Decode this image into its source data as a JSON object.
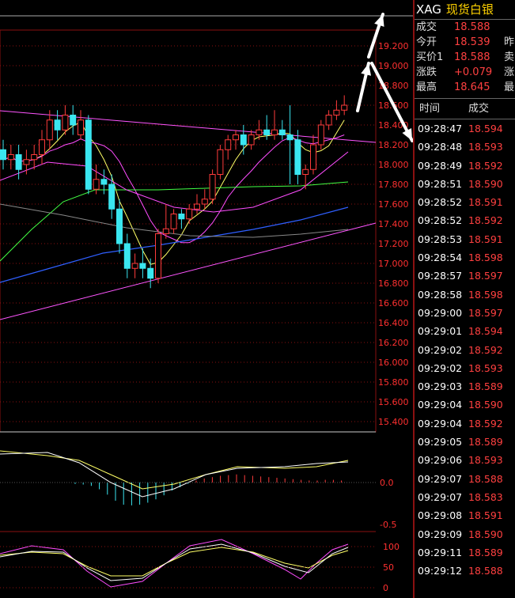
{
  "header": {
    "symbol": "XAG",
    "name": "现货白银"
  },
  "quote": [
    {
      "label": "成交",
      "value": "18.588",
      "cut": ""
    },
    {
      "label": "今开",
      "value": "18.539",
      "cut": "昨"
    },
    {
      "label": "买价1",
      "value": "18.588",
      "cut": "卖"
    },
    {
      "label": "涨跌",
      "value": "+0.079",
      "cut": "涨"
    },
    {
      "label": "最高",
      "value": "18.645",
      "cut": "最"
    }
  ],
  "ticks_header": {
    "time": "时间",
    "price": "成交"
  },
  "ticks": [
    {
      "time": "09:28:47",
      "price": "18.594"
    },
    {
      "time": "09:28:48",
      "price": "18.593"
    },
    {
      "time": "09:28:49",
      "price": "18.592"
    },
    {
      "time": "09:28:51",
      "price": "18.590"
    },
    {
      "time": "09:28:52",
      "price": "18.591"
    },
    {
      "time": "09:28:52",
      "price": "18.592"
    },
    {
      "time": "09:28:53",
      "price": "18.591"
    },
    {
      "time": "09:28:54",
      "price": "18.598"
    },
    {
      "time": "09:28:57",
      "price": "18.597"
    },
    {
      "time": "09:28:58",
      "price": "18.598"
    },
    {
      "time": "09:29:00",
      "price": "18.597"
    },
    {
      "time": "09:29:01",
      "price": "18.594"
    },
    {
      "time": "09:29:02",
      "price": "18.592"
    },
    {
      "time": "09:29:02",
      "price": "18.593"
    },
    {
      "time": "09:29:03",
      "price": "18.589"
    },
    {
      "time": "09:29:04",
      "price": "18.590"
    },
    {
      "time": "09:29:04",
      "price": "18.592"
    },
    {
      "time": "09:29:05",
      "price": "18.589"
    },
    {
      "time": "09:29:06",
      "price": "18.593"
    },
    {
      "time": "09:29:07",
      "price": "18.588"
    },
    {
      "time": "09:29:07",
      "price": "18.583"
    },
    {
      "time": "09:29:08",
      "price": "18.591"
    },
    {
      "time": "09:29:09",
      "price": "18.590"
    },
    {
      "time": "09:29:11",
      "price": "18.589"
    },
    {
      "time": "09:29:12",
      "price": "18.588"
    }
  ],
  "chart_data": {
    "type": "candlestick",
    "price_axis_ticks": [
      "19.200",
      "19.000",
      "18.800",
      "18.600",
      "18.400",
      "18.200",
      "18.000",
      "17.800",
      "17.600",
      "17.400",
      "17.200",
      "17.000",
      "16.800",
      "16.600",
      "16.400",
      "16.200",
      "16.000",
      "15.800",
      "15.600",
      "15.400"
    ],
    "macd_axis_ticks": [
      "0.0",
      "-0.5"
    ],
    "kdj_axis_ticks": [
      "100",
      "50",
      "0"
    ],
    "candles": [
      [
        18.15,
        18.05,
        18.25,
        17.95
      ],
      [
        18.05,
        18.1,
        18.2,
        17.95
      ],
      [
        18.1,
        17.95,
        18.2,
        17.85
      ],
      [
        18.0,
        18.05,
        18.15,
        17.9
      ],
      [
        18.05,
        18.1,
        18.2,
        17.95
      ],
      [
        18.1,
        18.25,
        18.35,
        18.0
      ],
      [
        18.25,
        18.45,
        18.55,
        18.15
      ],
      [
        18.45,
        18.35,
        18.55,
        18.25
      ],
      [
        18.35,
        18.5,
        18.6,
        18.3
      ],
      [
        18.5,
        18.4,
        18.6,
        18.3
      ],
      [
        18.3,
        18.45,
        18.55,
        18.25
      ],
      [
        18.45,
        17.75,
        18.5,
        17.7
      ],
      [
        17.75,
        17.85,
        18.0,
        17.7
      ],
      [
        17.85,
        17.8,
        17.95,
        17.7
      ],
      [
        17.8,
        17.55,
        17.9,
        17.45
      ],
      [
        17.55,
        17.2,
        17.65,
        17.1
      ],
      [
        17.2,
        16.95,
        17.3,
        16.85
      ],
      [
        16.95,
        17.0,
        17.1,
        16.85
      ],
      [
        17.0,
        16.95,
        17.15,
        16.85
      ],
      [
        16.95,
        16.85,
        17.05,
        16.75
      ],
      [
        16.85,
        17.3,
        17.35,
        16.8
      ],
      [
        17.3,
        17.35,
        17.6,
        17.25
      ],
      [
        17.35,
        17.5,
        17.55,
        17.3
      ],
      [
        17.5,
        17.45,
        17.55,
        17.35
      ],
      [
        17.45,
        17.55,
        17.6,
        17.4
      ],
      [
        17.55,
        17.6,
        17.7,
        17.5
      ],
      [
        17.6,
        17.65,
        17.75,
        17.55
      ],
      [
        17.65,
        17.9,
        17.95,
        17.6
      ],
      [
        17.9,
        18.15,
        18.2,
        17.85
      ],
      [
        18.15,
        18.25,
        18.3,
        18.05
      ],
      [
        18.25,
        18.3,
        18.35,
        18.15
      ],
      [
        18.3,
        18.2,
        18.4,
        18.1
      ],
      [
        18.2,
        18.3,
        18.35,
        18.15
      ],
      [
        18.3,
        18.35,
        18.45,
        18.25
      ],
      [
        18.35,
        18.3,
        18.5,
        18.25
      ],
      [
        18.3,
        18.35,
        18.55,
        18.25
      ],
      [
        18.35,
        18.3,
        18.45,
        18.25
      ],
      [
        18.3,
        18.25,
        18.6,
        17.8
      ],
      [
        18.25,
        17.9,
        18.35,
        17.8
      ],
      [
        17.9,
        17.95,
        18.0,
        17.75
      ],
      [
        17.95,
        18.2,
        18.3,
        17.9
      ],
      [
        18.2,
        18.4,
        18.45,
        18.15
      ],
      [
        18.4,
        18.5,
        18.55,
        18.35
      ],
      [
        18.5,
        18.55,
        18.65,
        18.45
      ],
      [
        18.55,
        18.6,
        18.7,
        18.5
      ]
    ],
    "macd_bars": [
      -0.02,
      -0.03,
      -0.05,
      -0.1,
      -0.18,
      -0.27,
      -0.33,
      -0.34,
      -0.33,
      -0.3,
      -0.25,
      -0.19,
      -0.12,
      -0.07,
      -0.02,
      0.03,
      0.06,
      0.08,
      0.1,
      0.11,
      0.12,
      0.11,
      0.1,
      0.09,
      0.08,
      0.07,
      0.06,
      0.05,
      0.04,
      0.03,
      0.03,
      0.04,
      0.04,
      0.03
    ],
    "colors": {
      "up": "#ff3b3b",
      "down": "#3ae6f0",
      "grid": "#8a1010",
      "ma5": "#ffffff",
      "ma10": "#ffff66",
      "ma20": "#ff4dff",
      "ma30": "#44ff44",
      "ma60": "#2f5fff",
      "ma120": "#888888",
      "trendline": "#ff55ff"
    }
  }
}
